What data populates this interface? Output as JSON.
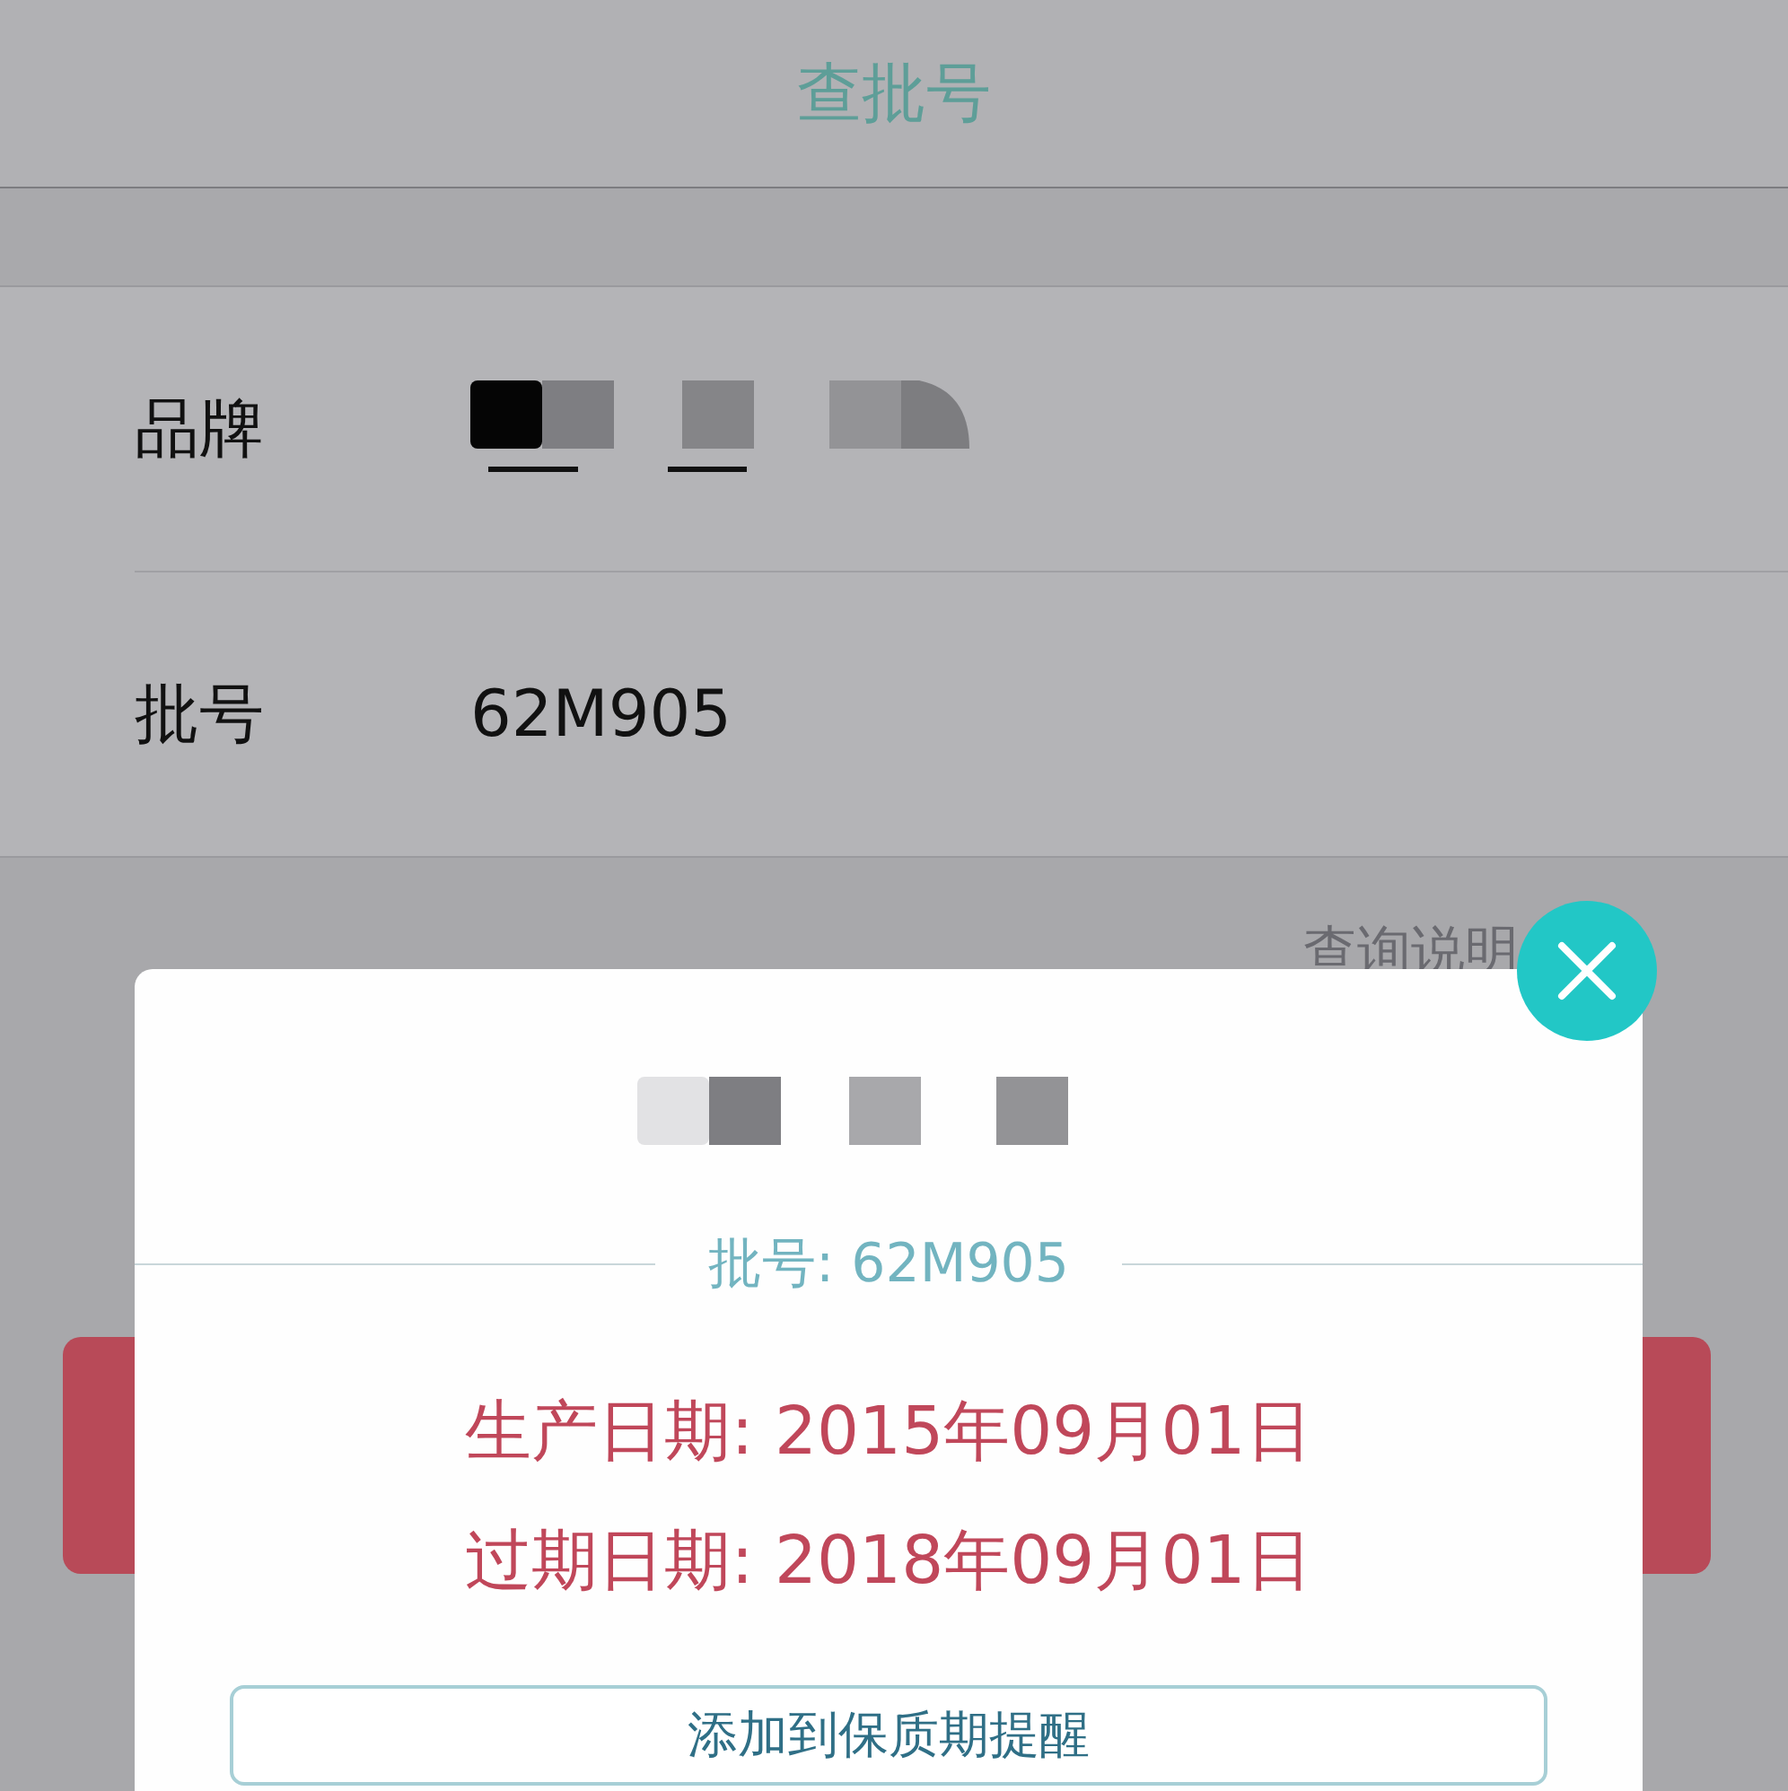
{
  "header": {
    "title": "查批号"
  },
  "fields": [
    {
      "label": "品牌",
      "kind": "redacted"
    },
    {
      "label": "批号",
      "kind": "text",
      "value": "62M905"
    }
  ],
  "help_link": "查询说明",
  "dialog": {
    "batch": "批号: 62M905",
    "dates": [
      "生产日期: 2015年09月01日",
      "过期日期: 2018年09月01日"
    ],
    "button": "添加到保质期提醒"
  }
}
